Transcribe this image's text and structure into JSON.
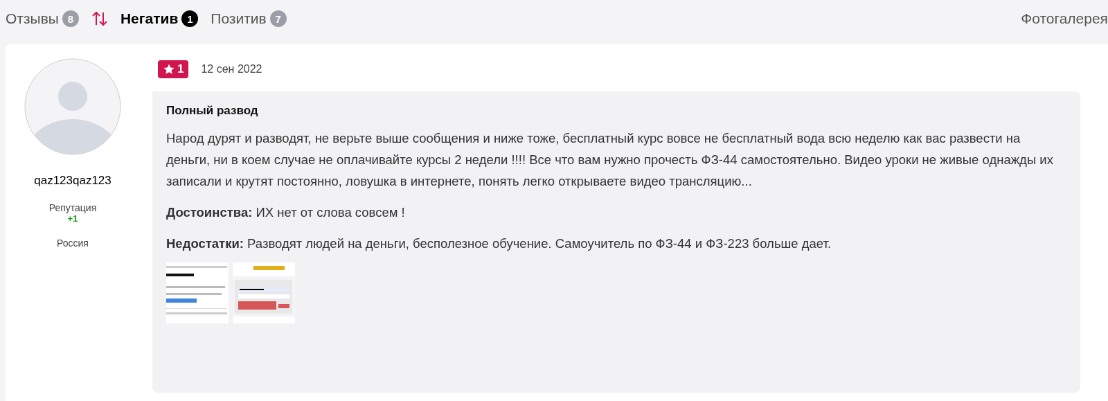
{
  "tabs": [
    {
      "label": "Отзывы",
      "count": "8",
      "selected": false
    },
    {
      "kind": "sort",
      "selected": false
    },
    {
      "label": "Негатив",
      "count": "1",
      "selected": true
    },
    {
      "label": "Позитив",
      "count": "7",
      "selected": false
    }
  ],
  "gallery_link": "Фотогалерея",
  "review": {
    "author": {
      "name": "qaz123qaz123",
      "reputation_label": "Репутация",
      "reputation": "+1",
      "country": "Россия"
    },
    "rating": "1",
    "date": "12 сен 2022",
    "title": "Полный развод",
    "text": "Народ дурят и разводят, не верьте выше сообщения и ниже тоже, бесплатный курс вовсе не бесплатный вода всю неделю как вас развести на деньги, ни в коем случае не оплачивайте курсы 2 недели !!!! Все что вам нужно прочесть ФЗ-44 самостоятельно. Видео уроки не живые однажды их записали и крутят постоянно, ловушка в интернете, понять легко открываете видео трансляцию...",
    "pros": {
      "label": "Достоинства:",
      "text": "ИХ нет от слова совсем !"
    },
    "cons": {
      "label": "Недостатки:",
      "text": "Разводят людей на деньги, бесполезное обучение. Самоучитель по ФЗ-44 и ФЗ-223 больше дает."
    }
  }
}
